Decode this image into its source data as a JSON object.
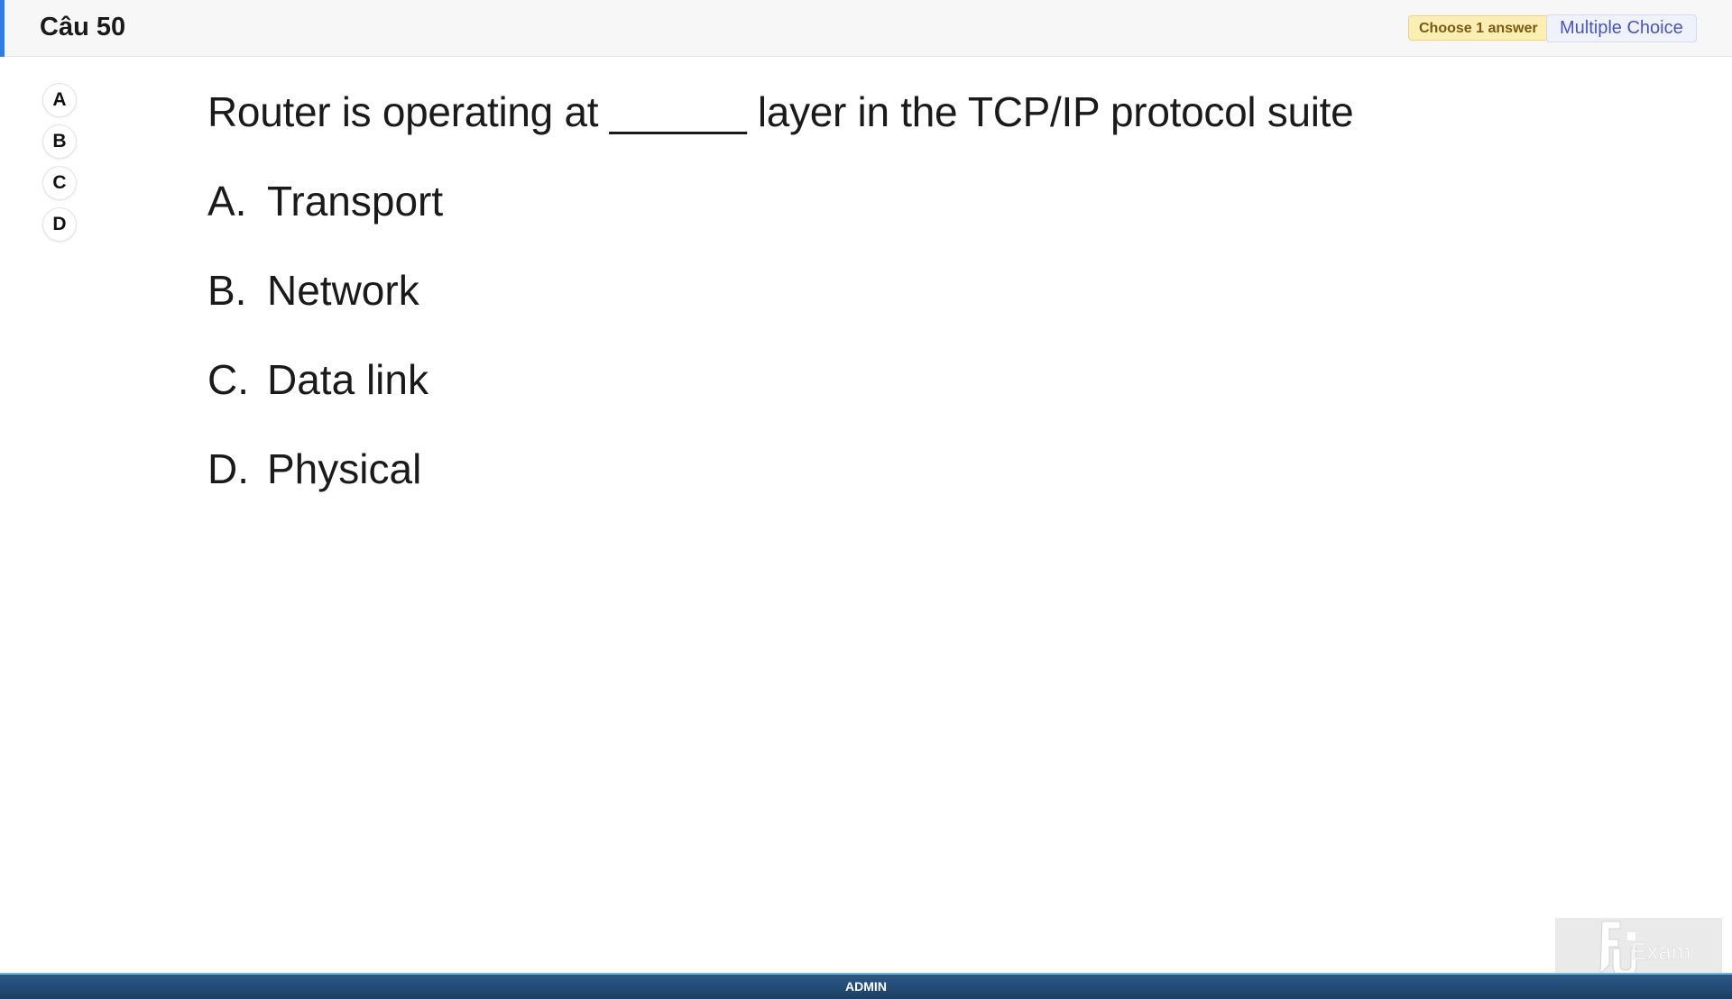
{
  "header": {
    "title": "Câu 50",
    "instruction_badge": "Choose 1 answer",
    "type_badge": "Multiple Choice"
  },
  "answer_options": [
    "A",
    "B",
    "C",
    "D"
  ],
  "question": {
    "text": "Router is operating at ______ layer in the TCP/IP protocol suite",
    "choices": [
      {
        "letter": "A.",
        "text": "Transport"
      },
      {
        "letter": "B.",
        "text": "Network"
      },
      {
        "letter": "C.",
        "text": "Data link"
      },
      {
        "letter": "D.",
        "text": "Physical"
      }
    ]
  },
  "footer": {
    "user": "ADMIN"
  },
  "watermark": {
    "logo_text": "FU Exam"
  },
  "colors": {
    "accent": "#2f7de1",
    "badge_yellow": "#fdeeb3",
    "badge_blue_text": "#4b55b8",
    "footer_bg": "#1c3e63"
  }
}
